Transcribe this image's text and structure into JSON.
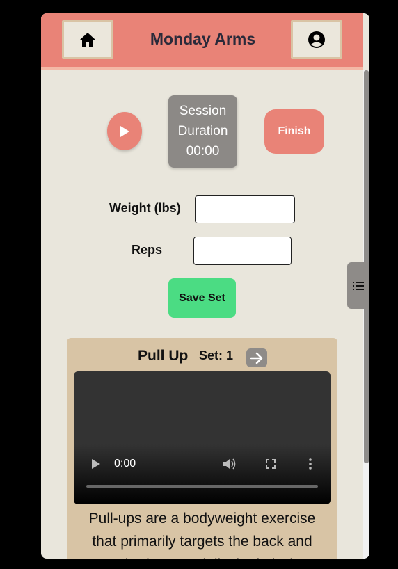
{
  "header": {
    "title": "Monday Arms",
    "home_icon": "home-icon",
    "profile_icon": "account-circle-icon"
  },
  "timer": {
    "play_icon": "play-icon",
    "session_label_1": "Session",
    "session_label_2": "Duration",
    "duration": "00:00",
    "finish_label": "Finish"
  },
  "form": {
    "weight_label": "Weight (lbs)",
    "weight_value": "",
    "reps_label": "Reps",
    "reps_value": "",
    "save_label": "Save Set"
  },
  "side_tab_icon": "list-icon",
  "exercise": {
    "name": "Pull Up",
    "set_label": "Set: 1",
    "next_icon": "arrow-right-icon",
    "video_time": "0:00",
    "description": "Pull-ups are a bodyweight exercise that primarily targets the back and upper body, especially the latissimus"
  },
  "colors": {
    "accent": "#e98377",
    "background": "#e9e6dc",
    "save": "#4bdc83",
    "card": "#d8c4a5",
    "neutral": "#8c8986"
  }
}
